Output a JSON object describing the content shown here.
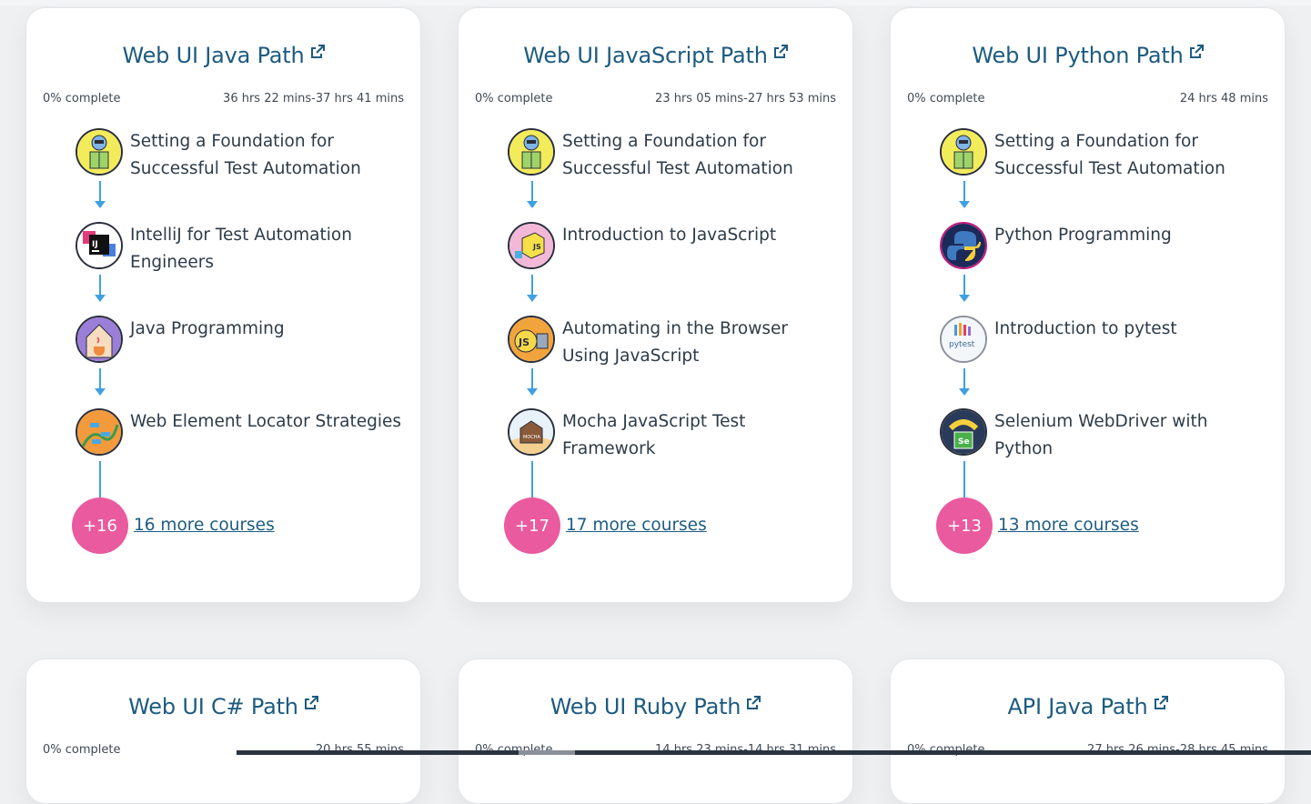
{
  "cards": [
    {
      "title": "Web UI Java Path",
      "percent": "0% complete",
      "duration": "36 hrs 22 mins-37 hrs 41 mins",
      "steps": [
        {
          "label": "Setting a Foundation for Successful Test Automation",
          "icon": "robot-blocks-icon"
        },
        {
          "label": "IntelliJ for Test Automation Engineers",
          "icon": "intellij-icon"
        },
        {
          "label": "Java Programming",
          "icon": "java-icon"
        },
        {
          "label": "Web Element Locator Strategies",
          "icon": "locator-vines-icon"
        }
      ],
      "more_badge": "+16",
      "more_link": "16 more courses"
    },
    {
      "title": "Web UI JavaScript Path",
      "percent": "0% complete",
      "duration": "23 hrs 05 mins-27 hrs 53 mins",
      "steps": [
        {
          "label": "Setting a Foundation for Successful Test Automation",
          "icon": "robot-blocks-icon"
        },
        {
          "label": "Introduction to JavaScript",
          "icon": "javascript-cube-icon"
        },
        {
          "label": "Automating in the Browser Using JavaScript",
          "icon": "js-browser-icon"
        },
        {
          "label": "Mocha JavaScript Test Framework",
          "icon": "mocha-icon"
        }
      ],
      "more_badge": "+17",
      "more_link": "17 more courses"
    },
    {
      "title": "Web UI Python Path",
      "percent": "0% complete",
      "duration": "24 hrs 48 mins",
      "steps": [
        {
          "label": "Setting a Foundation for Successful Test Automation",
          "icon": "robot-blocks-icon"
        },
        {
          "label": "Python Programming",
          "icon": "python-icon"
        },
        {
          "label": "Introduction to pytest",
          "icon": "pytest-icon"
        },
        {
          "label": "Selenium WebDriver with Python",
          "icon": "selenium-python-icon"
        }
      ],
      "more_badge": "+13",
      "more_link": "13 more courses"
    },
    {
      "title": "Web UI C# Path",
      "percent": "0% complete",
      "duration": "20 hrs 55 mins"
    },
    {
      "title": "Web UI Ruby Path",
      "percent": "0% complete",
      "duration": "14 hrs 23 mins-14 hrs 31 mins"
    },
    {
      "title": "API Java Path",
      "percent": "0% complete",
      "duration": "27 hrs 26 mins-28 hrs 45 mins"
    }
  ],
  "colors": {
    "title": "#1d5b80",
    "connector": "#3fa0e4",
    "badge": "#ea5a9e",
    "card": "#ffffff",
    "page": "#eef0f2"
  }
}
